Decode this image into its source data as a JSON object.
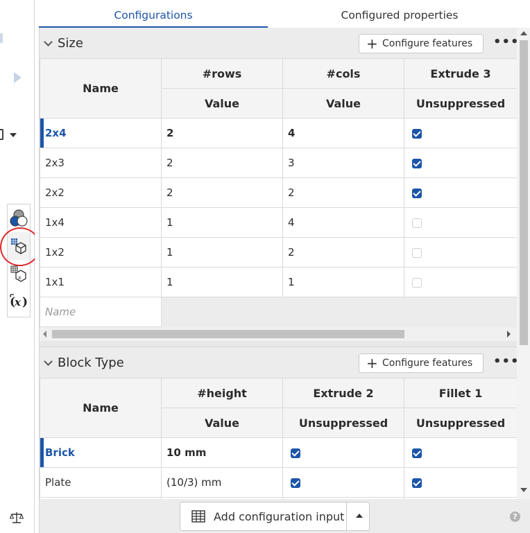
{
  "tabs": [
    {
      "label": "Configurations",
      "active": true
    },
    {
      "label": "Configured properties",
      "active": false
    }
  ],
  "configure_features_label": "Configure features",
  "sections": {
    "size": {
      "title": "Size",
      "header_top": [
        "",
        "#rows",
        "#cols",
        "Extrude 3"
      ],
      "header_bottom": [
        "Name",
        "Value",
        "Value",
        "Unsuppressed"
      ],
      "rows": [
        {
          "name": "2x4",
          "rows": "2",
          "cols": "4",
          "extrude3": true,
          "selected": true
        },
        {
          "name": "2x3",
          "rows": "2",
          "cols": "3",
          "extrude3": true,
          "selected": false
        },
        {
          "name": "2x2",
          "rows": "2",
          "cols": "2",
          "extrude3": true,
          "selected": false
        },
        {
          "name": "1x4",
          "rows": "1",
          "cols": "4",
          "extrude3": false,
          "selected": false
        },
        {
          "name": "1x2",
          "rows": "1",
          "cols": "2",
          "extrude3": false,
          "selected": false
        },
        {
          "name": "1x1",
          "rows": "1",
          "cols": "1",
          "extrude3": false,
          "selected": false
        }
      ],
      "new_row_placeholder": "Name"
    },
    "block_type": {
      "title": "Block Type",
      "header_top": [
        "",
        "#height",
        "Extrude 2",
        "Fillet 1"
      ],
      "header_bottom": [
        "Name",
        "Value",
        "Unsuppressed",
        "Unsuppressed"
      ],
      "rows": [
        {
          "name": "Brick",
          "height": "10 mm",
          "extrude2": true,
          "fillet1": true,
          "selected": true
        },
        {
          "name": "Plate",
          "height": "(10/3) mm",
          "extrude2": true,
          "fillet1": true,
          "selected": false
        }
      ]
    }
  },
  "footer": {
    "add_label": "Add configuration input",
    "help_glyph": "?"
  },
  "colors": {
    "accent": "#1c55a8",
    "annotation_circle": "#e0282d"
  },
  "left_toolbar_icons": [
    "appearance-icon",
    "configurations-icon",
    "variable-studio-icon",
    "variables-icon"
  ]
}
